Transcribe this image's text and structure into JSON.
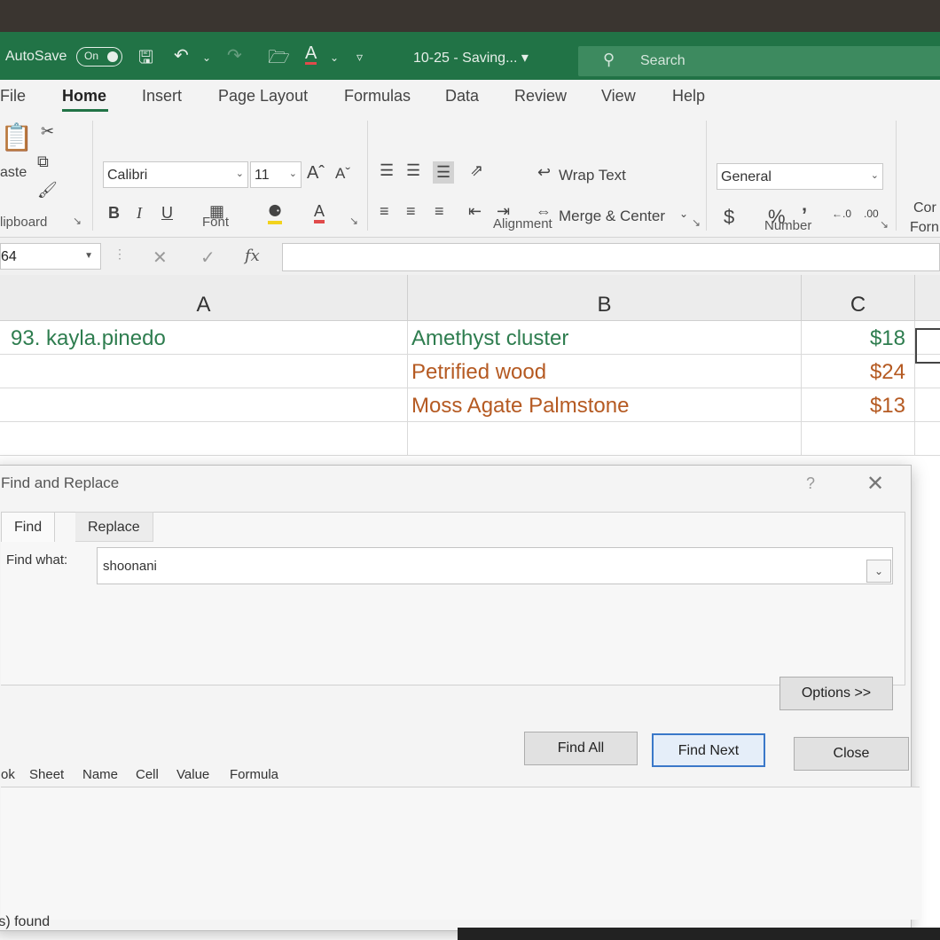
{
  "titlebar": {
    "autosave_label": "AutoSave",
    "autosave_state": "On",
    "file_title": "10-25 - Saving... ▾",
    "search_placeholder": "Search",
    "accent": "#217346"
  },
  "tabs": [
    "File",
    "Home",
    "Insert",
    "Page Layout",
    "Formulas",
    "Data",
    "Review",
    "View",
    "Help"
  ],
  "ribbon": {
    "clipboard": {
      "paste_label": "aste",
      "group_label": "lipboard"
    },
    "font": {
      "name": "Calibri",
      "size": "11",
      "bold": "B",
      "italic": "I",
      "underline": "U",
      "group_label": "Font"
    },
    "alignment": {
      "wrap_text": "Wrap Text",
      "merge_center": "Merge & Center",
      "group_label": "Alignment"
    },
    "number": {
      "format": "General",
      "currency": "$",
      "percent": "%",
      "comma": "̹",
      "group_label": "Number"
    },
    "styles": {
      "line1": "Cor",
      "line2": "Forn"
    }
  },
  "formula_bar": {
    "name_box": "64",
    "fx": "fx",
    "content": ""
  },
  "columns": [
    "A",
    "B",
    "C"
  ],
  "rows": [
    {
      "a": "93. kayla.pinedo",
      "b": "Amethyst cluster",
      "c": "$18",
      "color": "#2e7d4f"
    },
    {
      "a": "",
      "b": "Petrified wood",
      "c": "$24",
      "color": "#b55a22"
    },
    {
      "a": "",
      "b": "Moss Agate Palmstone",
      "c": "$13",
      "color": "#b55a22"
    },
    {
      "a": "",
      "b": "",
      "c": "",
      "color": "#333333"
    }
  ],
  "dialog": {
    "title": "Find and Replace",
    "help": "?",
    "close_glyph": "✕",
    "tab_find": "Find",
    "tab_replace": "Replace",
    "find_what_label": "Find what:",
    "find_what_value": "shoonani",
    "options_button": "Options >>",
    "find_all_button": "Find All",
    "find_next_button": "Find Next",
    "close_button": "Close",
    "results_columns": [
      "ok",
      "Sheet",
      "Name",
      "Cell",
      "Value",
      "Formula"
    ],
    "status": "(s) found"
  }
}
